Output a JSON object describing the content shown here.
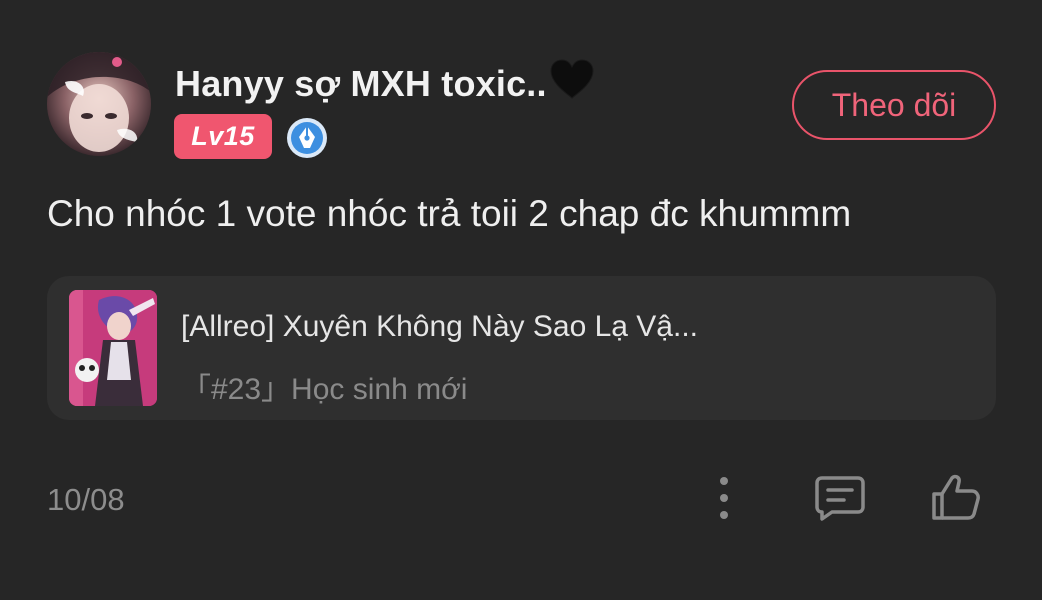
{
  "post": {
    "username": "Hanyy sợ MXH toxic..",
    "level": "Lv15",
    "follow_label": "Theo dõi",
    "content": "Cho nhóc 1 vote nhóc trả toii 2 chap đc khummm",
    "linked_story": {
      "title": "[Allreo] Xuyên Không Này Sao Lạ Vậ...",
      "chapter": "「#23」Học sinh mới"
    },
    "date": "10/08"
  },
  "icons": {
    "heart": "black-heart-icon",
    "verify": "pen-nib-badge-icon",
    "more": "more-vertical-icon",
    "comment": "comment-icon",
    "like": "thumbs-up-icon"
  },
  "colors": {
    "background": "#262626",
    "card_background": "#2f2f2f",
    "accent": "#f0566f",
    "verify_blue": "#3d8fe0"
  }
}
